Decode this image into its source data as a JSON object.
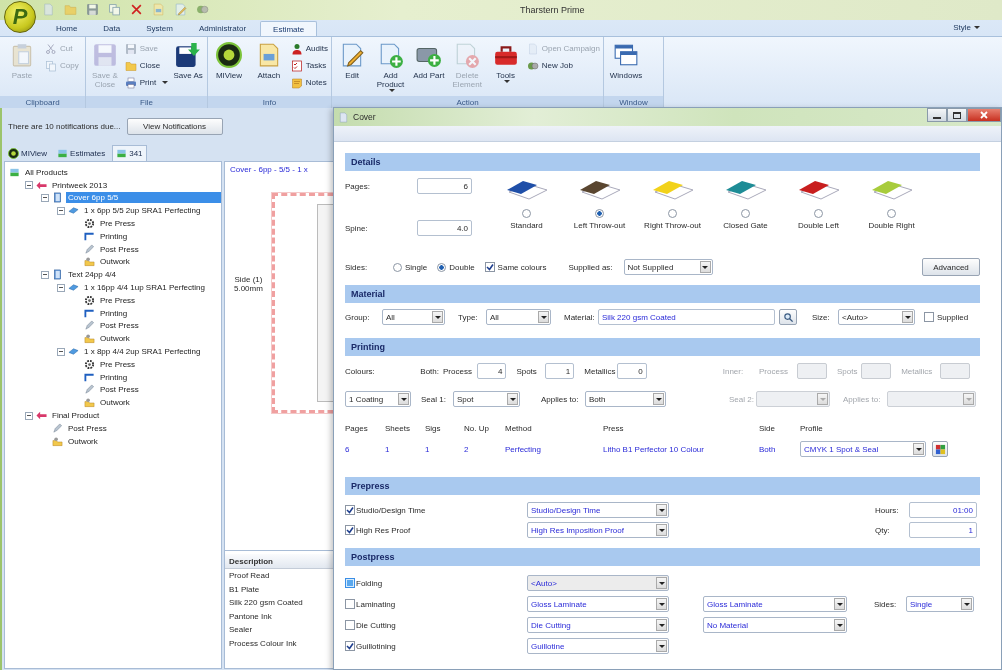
{
  "app": {
    "logo": "P",
    "title": "Tharstern Prime",
    "style_menu": "Style"
  },
  "ribbon": {
    "tabs": [
      {
        "label": "Home",
        "selected": false
      },
      {
        "label": "Data",
        "selected": false
      },
      {
        "label": "System",
        "selected": false
      },
      {
        "label": "Administrator",
        "selected": false
      },
      {
        "label": "Estimate",
        "selected": true
      }
    ],
    "groups": [
      {
        "label": "Clipboard",
        "buttons": [
          {
            "label": "Paste",
            "kind": "large",
            "disabled": true
          },
          {
            "label": "Cut",
            "kind": "small",
            "disabled": true
          },
          {
            "label": "Copy",
            "kind": "small",
            "disabled": true
          }
        ]
      },
      {
        "label": "File",
        "buttons": [
          {
            "label": "Save & Close",
            "kind": "large",
            "disabled": true
          },
          {
            "label": "Save",
            "kind": "small",
            "disabled": true
          },
          {
            "label": "Close",
            "kind": "small",
            "disabled": false
          },
          {
            "label": "Print",
            "kind": "small",
            "disabled": false,
            "dropdown": true
          },
          {
            "label": "Save As",
            "kind": "large",
            "disabled": false
          }
        ]
      },
      {
        "label": "Info",
        "buttons": [
          {
            "label": "MIView",
            "kind": "large",
            "disabled": false
          },
          {
            "label": "Attach",
            "kind": "large",
            "disabled": false
          },
          {
            "label": "Audits",
            "kind": "small",
            "disabled": false
          },
          {
            "label": "Tasks",
            "kind": "small",
            "disabled": false
          },
          {
            "label": "Notes",
            "kind": "small",
            "disabled": false
          }
        ]
      },
      {
        "label": "Action",
        "buttons": [
          {
            "label": "Edit",
            "kind": "large",
            "disabled": false
          },
          {
            "label": "Add Product",
            "kind": "large",
            "disabled": false,
            "dropdown": true
          },
          {
            "label": "Add Part",
            "kind": "large",
            "disabled": false
          },
          {
            "label": "Delete Element",
            "kind": "large",
            "disabled": true
          },
          {
            "label": "Tools",
            "kind": "large",
            "disabled": false,
            "dropdown": true
          },
          {
            "label": "Open Campaign",
            "kind": "small",
            "disabled": true
          },
          {
            "label": "New Job",
            "kind": "small",
            "disabled": false
          }
        ]
      },
      {
        "label": "Window",
        "buttons": [
          {
            "label": "Windows",
            "kind": "large",
            "disabled": false
          }
        ]
      }
    ]
  },
  "notification": {
    "text": "There are 10 notifications due...",
    "button": "View Notifications"
  },
  "document_tabs": [
    {
      "label": "MIView",
      "selected": false
    },
    {
      "label": "Estimates",
      "selected": false
    },
    {
      "label": "341",
      "selected": true
    }
  ],
  "tree": [
    {
      "label": "All Products",
      "kind": "root",
      "selected": false,
      "children": [
        {
          "label": "Printweek 2013",
          "kind": "product",
          "expanded": true,
          "selected": false,
          "children": [
            {
              "label": "Cover 6pp 5/5",
              "kind": "part",
              "expanded": true,
              "selected": true,
              "children": [
                {
                  "label": "1 x 6pp 5/5 2up SRA1 Perfecting",
                  "kind": "section",
                  "expanded": true,
                  "selected": false,
                  "children": [
                    {
                      "label": "Pre Press",
                      "kind": "prepress",
                      "selected": false
                    },
                    {
                      "label": "Printing",
                      "kind": "printing",
                      "selected": false
                    },
                    {
                      "label": "Post Press",
                      "kind": "postpress",
                      "selected": false
                    },
                    {
                      "label": "Outwork",
                      "kind": "outwork",
                      "selected": false
                    }
                  ]
                }
              ]
            },
            {
              "label": "Text 24pp 4/4",
              "kind": "part",
              "expanded": true,
              "selected": false,
              "children": [
                {
                  "label": "1 x 16pp 4/4 1up SRA1 Perfecting",
                  "kind": "section",
                  "expanded": true,
                  "selected": false,
                  "children": [
                    {
                      "label": "Pre Press",
                      "kind": "prepress",
                      "selected": false
                    },
                    {
                      "label": "Printing",
                      "kind": "printing",
                      "selected": false
                    },
                    {
                      "label": "Post Press",
                      "kind": "postpress",
                      "selected": false
                    },
                    {
                      "label": "Outwork",
                      "kind": "outwork",
                      "selected": false
                    }
                  ]
                },
                {
                  "label": "1 x 8pp 4/4 2up SRA1 Perfecting",
                  "kind": "section",
                  "expanded": true,
                  "selected": false,
                  "children": [
                    {
                      "label": "Pre Press",
                      "kind": "prepress",
                      "selected": false
                    },
                    {
                      "label": "Printing",
                      "kind": "printing",
                      "selected": false
                    },
                    {
                      "label": "Post Press",
                      "kind": "postpress",
                      "selected": false
                    },
                    {
                      "label": "Outwork",
                      "kind": "outwork",
                      "selected": false
                    }
                  ]
                }
              ]
            }
          ]
        },
        {
          "label": "Final Product",
          "kind": "product",
          "expanded": true,
          "selected": false,
          "children": [
            {
              "label": "Post Press",
              "kind": "postpress",
              "selected": false
            },
            {
              "label": "Outwork",
              "kind": "outwork",
              "selected": false
            }
          ]
        }
      ]
    }
  ],
  "preview": {
    "heading": "Cover - 6pp - 5/5 - 1 x",
    "side_label": "Side (1)",
    "margin_label": "5.00mm",
    "description": {
      "header": "Description",
      "rows": [
        "Proof Read",
        "B1 Plate",
        "Silk 220 gsm Coated",
        "Pantone Ink",
        "Sealer",
        "Process Colour Ink"
      ]
    }
  },
  "dialog": {
    "title": "Cover",
    "details": {
      "title": "Details",
      "pages": {
        "label": "Pages:",
        "value": "6"
      },
      "spine": {
        "label": "Spine:",
        "value": "4.0"
      },
      "bindings": [
        {
          "label": "Standard",
          "selected": false,
          "color": "#1f4fa8"
        },
        {
          "label": "Left Throw-out",
          "selected": true,
          "color": "#5a4630"
        },
        {
          "label": "Right Throw-out",
          "selected": false,
          "color": "#f2d21a"
        },
        {
          "label": "Closed Gate",
          "selected": false,
          "color": "#1e8c96"
        },
        {
          "label": "Double Left",
          "selected": false,
          "color": "#c81e1e"
        },
        {
          "label": "Double Right",
          "selected": false,
          "color": "#a8cc3c"
        }
      ],
      "sides": {
        "label": "Sides:",
        "options": [
          {
            "label": "Single",
            "selected": false
          },
          {
            "label": "Double",
            "selected": true
          }
        ]
      },
      "same_colours": {
        "label": "Same colours",
        "checked": true
      },
      "supplied_as": {
        "label": "Supplied as:",
        "value": "Not Supplied"
      },
      "advanced_button": "Advanced"
    },
    "material": {
      "title": "Material",
      "group": {
        "label": "Group:",
        "value": "All"
      },
      "type": {
        "label": "Type:",
        "value": "All"
      },
      "material": {
        "label": "Material:",
        "value": "Silk 220 gsm Coated"
      },
      "size": {
        "label": "Size:",
        "value": "<Auto>"
      },
      "supplied": {
        "label": "Supplied",
        "checked": false
      }
    },
    "printing": {
      "title": "Printing",
      "colours_label": "Colours:",
      "colour_groups": [
        {
          "label": "Both:",
          "disabled": false,
          "fields": [
            {
              "label": "Process",
              "value": "4"
            },
            {
              "label": "Spots",
              "value": "1"
            },
            {
              "label": "Metallics",
              "value": "0"
            }
          ]
        },
        {
          "label": "Inner:",
          "disabled": true,
          "fields": [
            {
              "label": "Process"
            },
            {
              "label": "Spots"
            },
            {
              "label": "Metallics"
            }
          ]
        }
      ],
      "coating": {
        "value": "1 Coating"
      },
      "seals": [
        {
          "label": "Seal 1:",
          "value": "Spot",
          "disabled": false
        },
        {
          "label": "Applies to:",
          "value": "Both",
          "disabled": false
        },
        {
          "label": "Seal 2:",
          "disabled": true
        },
        {
          "label": "Applies to:",
          "disabled": true
        }
      ],
      "columns": [
        "Pages",
        "Sheets",
        "Sigs",
        "No. Up",
        "Method",
        "Press",
        "Side",
        "Profile"
      ],
      "rows": [
        {
          "cells": [
            "6",
            "1",
            "1",
            "2",
            "Perfecting",
            "Litho B1 Perfector 10 Colour",
            "Both"
          ],
          "profile": "CMYK 1 Spot & Seal"
        }
      ]
    },
    "prepress": {
      "title": "Prepress",
      "items": [
        {
          "label": "Studio/Design Time",
          "checked": true,
          "value": "Studio/Design Time"
        },
        {
          "label": "High Res Proof",
          "checked": true,
          "value": "High Res Imposition Proof"
        }
      ],
      "totals": [
        {
          "label": "Hours:",
          "value": "01:00"
        },
        {
          "label": "Qty:",
          "value": "1"
        }
      ]
    },
    "postpress": {
      "title": "Postpress",
      "items": [
        {
          "label": "Folding",
          "checked": false,
          "indeterminate": true,
          "options": [
            {
              "value": "<Auto>",
              "disabled": true
            }
          ]
        },
        {
          "label": "Laminating",
          "checked": false,
          "indeterminate": false,
          "options": [
            {
              "value": "Gloss Laminate",
              "disabled": false
            },
            {
              "value": "Gloss Laminate",
              "disabled": false
            }
          ],
          "sides": {
            "label": "Sides:",
            "value": "Single"
          }
        },
        {
          "label": "Die Cutting",
          "checked": false,
          "indeterminate": false,
          "options": [
            {
              "value": "Die Cutting",
              "disabled": false
            },
            {
              "value": "No Material",
              "disabled": false
            }
          ]
        },
        {
          "label": "Guillotining",
          "checked": true,
          "indeterminate": false,
          "options": [
            {
              "value": "Guillotine",
              "disabled": false
            }
          ]
        }
      ]
    }
  }
}
